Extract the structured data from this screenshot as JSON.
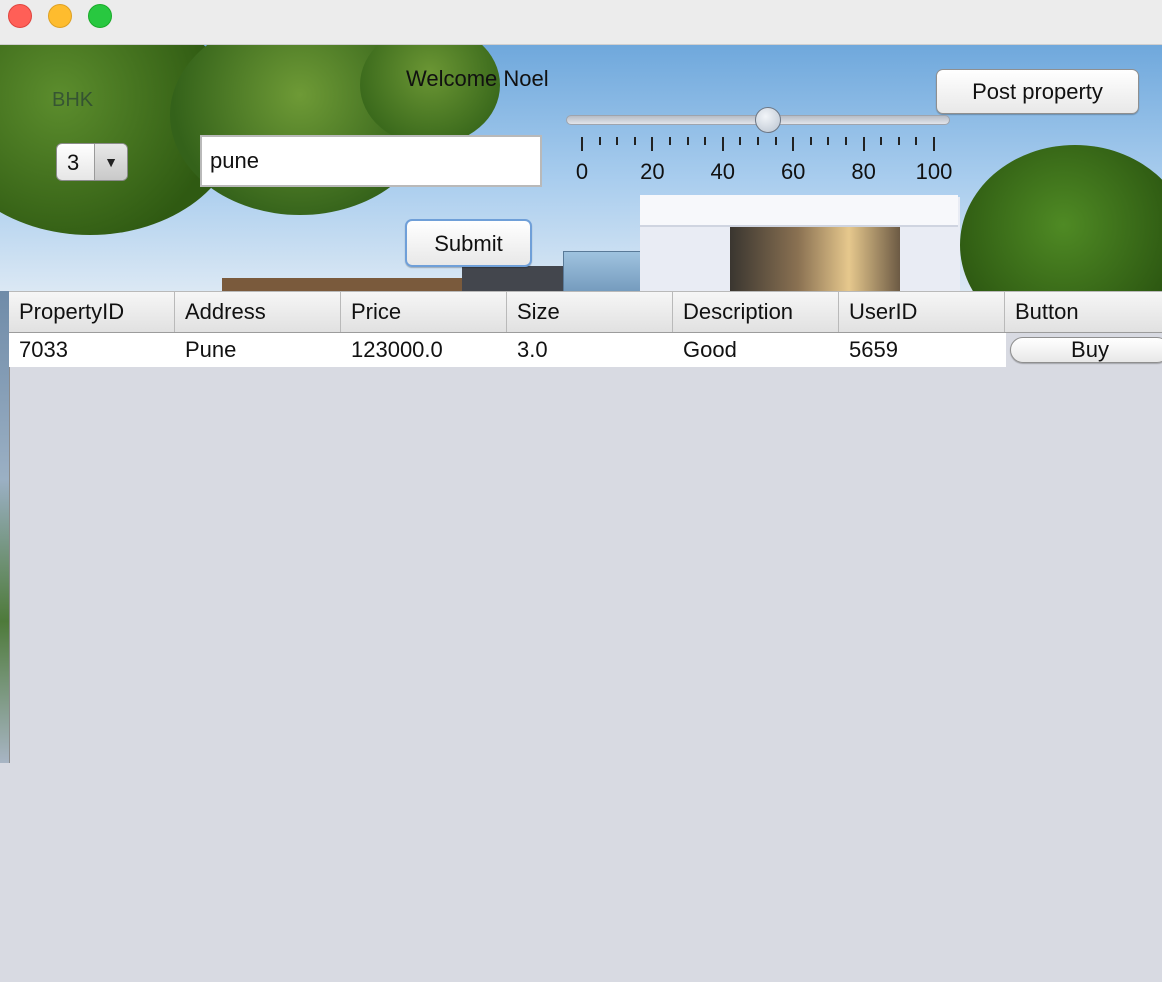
{
  "window": {
    "controls": [
      "close",
      "minimize",
      "maximize"
    ]
  },
  "header": {
    "welcome": "Welcome Noel",
    "bhk_label": "BHK",
    "post_button": "Post property"
  },
  "filters": {
    "bhk_value": "3",
    "search_value": "pune",
    "submit_label": "Submit",
    "slider": {
      "value": 50,
      "min": 0,
      "max": 100,
      "labels": [
        "0",
        "20",
        "40",
        "60",
        "80",
        "100"
      ]
    }
  },
  "table": {
    "columns": [
      "PropertyID",
      "Address",
      "Price",
      "Size",
      "Description",
      "UserID",
      "Button"
    ],
    "rows": [
      {
        "cells": [
          "7033",
          "Pune",
          "123000.0",
          "3.0",
          "Good",
          "5659"
        ],
        "button": "Buy"
      }
    ]
  },
  "colors": {
    "table_bg": "#d8dae2",
    "accent": "#6f9fd8"
  }
}
